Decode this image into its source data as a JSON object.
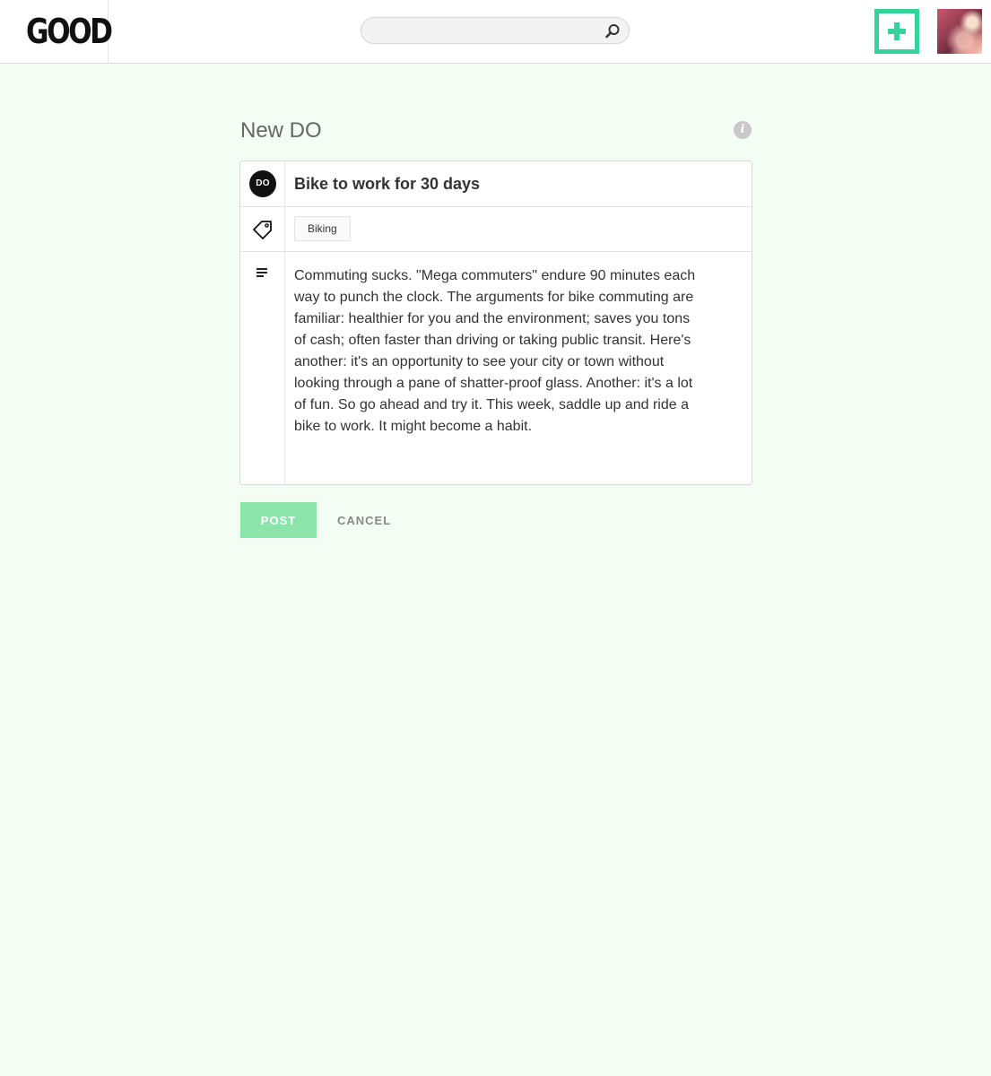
{
  "header": {
    "logo_text": "GOOD",
    "search": {
      "value": "",
      "placeholder": ""
    },
    "accent_color": "#33d49b"
  },
  "page": {
    "title": "New DO",
    "info_icon_glyph": "i"
  },
  "form": {
    "badge_text": "DO",
    "title_value": "Bike to work for 30 days",
    "tags": [
      "Biking"
    ],
    "description": "Commuting sucks. \"Mega commuters\" endure 90 minutes each way to punch the clock. The arguments for bike commuting are familiar: healthier for you and the environment; saves you tons of cash; often faster than driving or taking public transit. Here's another: it's an opportunity to see your city or town without looking through a pane of shatter-proof glass. Another: it's a lot of fun. So go ahead and try it. This week, saddle up and ride a bike to work. It might become a habit."
  },
  "actions": {
    "post_label": "POST",
    "cancel_label": "CANCEL",
    "post_color": "#8be4a9"
  },
  "icons": {
    "search": "search-icon",
    "add": "plus-icon",
    "info": "info-icon",
    "tag": "tag-icon",
    "description": "text-lines-icon"
  }
}
